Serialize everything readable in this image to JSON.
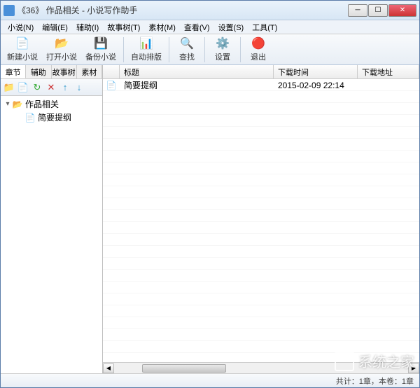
{
  "window": {
    "title": "《36》 作品相关 - 小说写作助手"
  },
  "menu": {
    "items": [
      "小说(N)",
      "编辑(E)",
      "辅助(I)",
      "故事树(T)",
      "素材(M)",
      "查看(V)",
      "设置(S)",
      "工具(T)"
    ]
  },
  "toolbar": {
    "new": "新建小说",
    "open": "打开小说",
    "backup": "备份小说",
    "auto": "自动排版",
    "find": "查找",
    "settings": "设置",
    "exit": "退出"
  },
  "sidebar": {
    "tabs": [
      "章节",
      "辅助",
      "故事树",
      "素材"
    ],
    "tree": {
      "root": "作品相关",
      "child": "简要提纲"
    }
  },
  "list": {
    "columns": {
      "title": "标题",
      "time": "下载时间",
      "url": "下载地址"
    },
    "rows": [
      {
        "title": "简要提纲",
        "time": "2015-02-09 22:14",
        "url": ""
      }
    ]
  },
  "status": {
    "text": "共计：1章，本卷：1章"
  },
  "watermark": "系统之家"
}
